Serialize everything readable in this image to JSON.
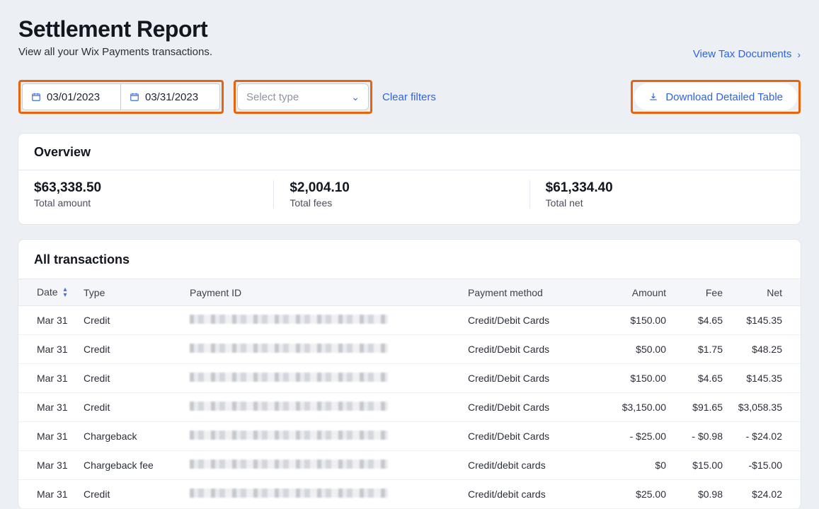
{
  "header": {
    "title": "Settlement Report",
    "subtitle": "View all your Wix Payments transactions.",
    "tax_link": "View Tax Documents"
  },
  "filters": {
    "date_from": "03/01/2023",
    "date_to": "03/31/2023",
    "type_placeholder": "Select type",
    "clear_label": "Clear filters",
    "download_label": "Download Detailed Table"
  },
  "overview": {
    "heading": "Overview",
    "total_amount": {
      "value": "$63,338.50",
      "label": "Total amount"
    },
    "total_fees": {
      "value": "$2,004.10",
      "label": "Total fees"
    },
    "total_net": {
      "value": "$61,334.40",
      "label": "Total net"
    }
  },
  "transactions": {
    "heading": "All transactions",
    "columns": {
      "date": "Date",
      "type": "Type",
      "pid": "Payment ID",
      "pm": "Payment method",
      "amount": "Amount",
      "fee": "Fee",
      "net": "Net"
    },
    "rows": [
      {
        "date": "Mar 31",
        "type": "Credit",
        "pm": "Credit/Debit Cards",
        "amount": "$150.00",
        "fee": "$4.65",
        "net": "$145.35"
      },
      {
        "date": "Mar 31",
        "type": "Credit",
        "pm": "Credit/Debit Cards",
        "amount": "$50.00",
        "fee": "$1.75",
        "net": "$48.25"
      },
      {
        "date": "Mar 31",
        "type": "Credit",
        "pm": "Credit/Debit Cards",
        "amount": "$150.00",
        "fee": "$4.65",
        "net": "$145.35"
      },
      {
        "date": "Mar 31",
        "type": "Credit",
        "pm": "Credit/Debit Cards",
        "amount": "$3,150.00",
        "fee": "$91.65",
        "net": "$3,058.35"
      },
      {
        "date": "Mar 31",
        "type": "Chargeback",
        "pm": "Credit/Debit Cards",
        "amount": "- $25.00",
        "fee": "- $0.98",
        "net": "- $24.02"
      },
      {
        "date": "Mar 31",
        "type": "Chargeback fee",
        "pm": "Credit/debit cards",
        "amount": "$0",
        "fee": "$15.00",
        "net": "-$15.00"
      },
      {
        "date": "Mar 31",
        "type": "Credit",
        "pm": "Credit/debit cards",
        "amount": "$25.00",
        "fee": "$0.98",
        "net": "$24.02"
      }
    ]
  }
}
